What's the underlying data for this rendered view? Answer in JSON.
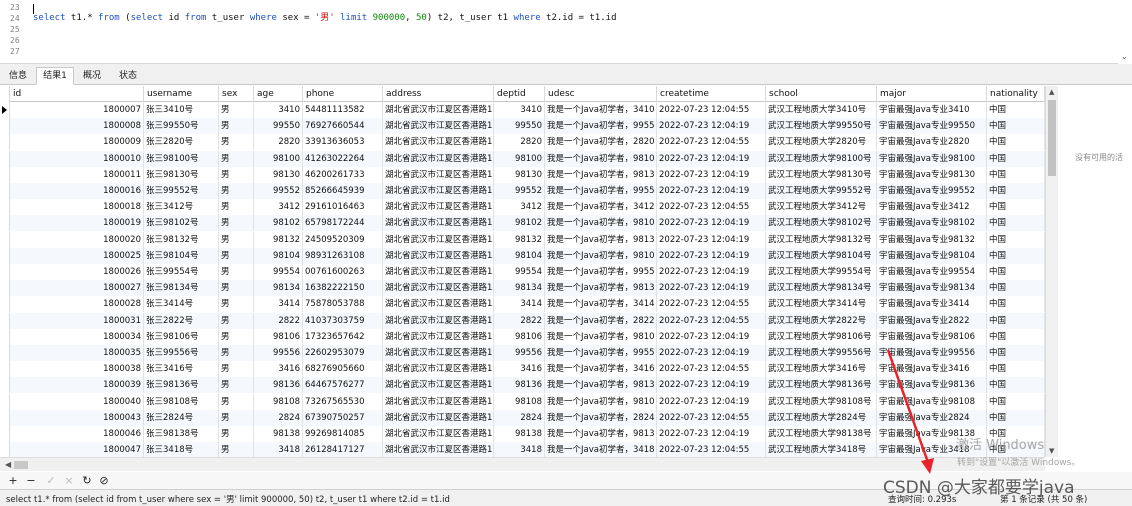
{
  "editor": {
    "line_numbers": [
      "23",
      "24",
      "25",
      "26",
      "27"
    ],
    "query_tokens": [
      {
        "t": "select",
        "c": "kw"
      },
      {
        "t": " t1.* ",
        "c": "txt"
      },
      {
        "t": "from",
        "c": "kw"
      },
      {
        "t": " (",
        "c": "txt"
      },
      {
        "t": "select",
        "c": "kw"
      },
      {
        "t": " id ",
        "c": "txt"
      },
      {
        "t": "from",
        "c": "kw"
      },
      {
        "t": " t_user ",
        "c": "txt"
      },
      {
        "t": "where",
        "c": "kw"
      },
      {
        "t": " sex = ",
        "c": "txt"
      },
      {
        "t": "'男'",
        "c": "str"
      },
      {
        "t": " ",
        "c": "txt"
      },
      {
        "t": "limit",
        "c": "kw"
      },
      {
        "t": " ",
        "c": "txt"
      },
      {
        "t": "900000",
        "c": "num"
      },
      {
        "t": ", ",
        "c": "txt"
      },
      {
        "t": "50",
        "c": "num"
      },
      {
        "t": ") t2, t_user t1 ",
        "c": "txt"
      },
      {
        "t": "where",
        "c": "kw"
      },
      {
        "t": " t2.id = t1.id",
        "c": "txt"
      }
    ]
  },
  "tabs": [
    "信息",
    "结果1",
    "概况",
    "状态"
  ],
  "active_tab": 1,
  "columns": [
    "id",
    "username",
    "sex",
    "age",
    "phone",
    "address",
    "deptid",
    "udesc",
    "createtime",
    "school",
    "major",
    "nationality"
  ],
  "rows": [
    [
      "1800007",
      "张三3410号",
      "男",
      "3410",
      "54481113582",
      "湖北省武汉市江夏区香港路1",
      "3410",
      "我是一个Java初学者，3410",
      "2022-07-23 12:04:55",
      "武汉工程地质大学3410号",
      "宇宙最强Java专业3410",
      "中国"
    ],
    [
      "1800008",
      "张三99550号",
      "男",
      "99550",
      "76927660544",
      "湖北省武汉市江夏区香港路1",
      "99550",
      "我是一个Java初学者，9955",
      "2022-07-23 12:04:19",
      "武汉工程地质大学99550号",
      "宇宙最强Java专业99550",
      "中国"
    ],
    [
      "1800009",
      "张三2820号",
      "男",
      "2820",
      "33913636053",
      "湖北省武汉市江夏区香港路1",
      "2820",
      "我是一个Java初学者，2820",
      "2022-07-23 12:04:55",
      "武汉工程地质大学2820号",
      "宇宙最强Java专业2820",
      "中国"
    ],
    [
      "1800010",
      "张三98100号",
      "男",
      "98100",
      "41263022264",
      "湖北省武汉市江夏区香港路1",
      "98100",
      "我是一个Java初学者，9810",
      "2022-07-23 12:04:19",
      "武汉工程地质大学98100号",
      "宇宙最强Java专业98100",
      "中国"
    ],
    [
      "1800011",
      "张三98130号",
      "男",
      "98130",
      "46200261733",
      "湖北省武汉市江夏区香港路1",
      "98130",
      "我是一个Java初学者，9813",
      "2022-07-23 12:04:19",
      "武汉工程地质大学98130号",
      "宇宙最强Java专业98130",
      "中国"
    ],
    [
      "1800016",
      "张三99552号",
      "男",
      "99552",
      "85266645939",
      "湖北省武汉市江夏区香港路1",
      "99552",
      "我是一个Java初学者，9955",
      "2022-07-23 12:04:19",
      "武汉工程地质大学99552号",
      "宇宙最强Java专业99552",
      "中国"
    ],
    [
      "1800018",
      "张三3412号",
      "男",
      "3412",
      "29161016463",
      "湖北省武汉市江夏区香港路1",
      "3412",
      "我是一个Java初学者，3412",
      "2022-07-23 12:04:55",
      "武汉工程地质大学3412号",
      "宇宙最强Java专业3412",
      "中国"
    ],
    [
      "1800019",
      "张三98102号",
      "男",
      "98102",
      "65798172244",
      "湖北省武汉市江夏区香港路1",
      "98102",
      "我是一个Java初学者，9810",
      "2022-07-23 12:04:19",
      "武汉工程地质大学98102号",
      "宇宙最强Java专业98102",
      "中国"
    ],
    [
      "1800020",
      "张三98132号",
      "男",
      "98132",
      "24509520309",
      "湖北省武汉市江夏区香港路1",
      "98132",
      "我是一个Java初学者，9813",
      "2022-07-23 12:04:19",
      "武汉工程地质大学98132号",
      "宇宙最强Java专业98132",
      "中国"
    ],
    [
      "1800025",
      "张三98104号",
      "男",
      "98104",
      "98931263108",
      "湖北省武汉市江夏区香港路1",
      "98104",
      "我是一个Java初学者，9810",
      "2022-07-23 12:04:19",
      "武汉工程地质大学98104号",
      "宇宙最强Java专业98104",
      "中国"
    ],
    [
      "1800026",
      "张三99554号",
      "男",
      "99554",
      "00761600263",
      "湖北省武汉市江夏区香港路1",
      "99554",
      "我是一个Java初学者，9955",
      "2022-07-23 12:04:19",
      "武汉工程地质大学99554号",
      "宇宙最强Java专业99554",
      "中国"
    ],
    [
      "1800027",
      "张三98134号",
      "男",
      "98134",
      "16382222150",
      "湖北省武汉市江夏区香港路1",
      "98134",
      "我是一个Java初学者，9813",
      "2022-07-23 12:04:19",
      "武汉工程地质大学98134号",
      "宇宙最强Java专业98134",
      "中国"
    ],
    [
      "1800028",
      "张三3414号",
      "男",
      "3414",
      "75878053788",
      "湖北省武汉市江夏区香港路1",
      "3414",
      "我是一个Java初学者，3414",
      "2022-07-23 12:04:55",
      "武汉工程地质大学3414号",
      "宇宙最强Java专业3414",
      "中国"
    ],
    [
      "1800031",
      "张三2822号",
      "男",
      "2822",
      "41037303759",
      "湖北省武汉市江夏区香港路1",
      "2822",
      "我是一个Java初学者，2822",
      "2022-07-23 12:04:55",
      "武汉工程地质大学2822号",
      "宇宙最强Java专业2822",
      "中国"
    ],
    [
      "1800034",
      "张三98106号",
      "男",
      "98106",
      "17323657642",
      "湖北省武汉市江夏区香港路1",
      "98106",
      "我是一个Java初学者，9810",
      "2022-07-23 12:04:19",
      "武汉工程地质大学98106号",
      "宇宙最强Java专业98106",
      "中国"
    ],
    [
      "1800035",
      "张三99556号",
      "男",
      "99556",
      "22602953079",
      "湖北省武汉市江夏区香港路1",
      "99556",
      "我是一个Java初学者，9955",
      "2022-07-23 12:04:19",
      "武汉工程地质大学99556号",
      "宇宙最强Java专业99556",
      "中国"
    ],
    [
      "1800038",
      "张三3416号",
      "男",
      "3416",
      "68276905660",
      "湖北省武汉市江夏区香港路1",
      "3416",
      "我是一个Java初学者，3416",
      "2022-07-23 12:04:55",
      "武汉工程地质大学3416号",
      "宇宙最强Java专业3416",
      "中国"
    ],
    [
      "1800039",
      "张三98136号",
      "男",
      "98136",
      "64467576277",
      "湖北省武汉市江夏区香港路1",
      "98136",
      "我是一个Java初学者，9813",
      "2022-07-23 12:04:19",
      "武汉工程地质大学98136号",
      "宇宙最强Java专业98136",
      "中国"
    ],
    [
      "1800040",
      "张三98108号",
      "男",
      "98108",
      "73267565530",
      "湖北省武汉市江夏区香港路1",
      "98108",
      "我是一个Java初学者，9810",
      "2022-07-23 12:04:19",
      "武汉工程地质大学98108号",
      "宇宙最强Java专业98108",
      "中国"
    ],
    [
      "1800043",
      "张三2824号",
      "男",
      "2824",
      "67390750257",
      "湖北省武汉市江夏区香港路1",
      "2824",
      "我是一个Java初学者，2824",
      "2022-07-23 12:04:55",
      "武汉工程地质大学2824号",
      "宇宙最强Java专业2824",
      "中国"
    ],
    [
      "1800046",
      "张三98138号",
      "男",
      "98138",
      "99269814085",
      "湖北省武汉市江夏区香港路1",
      "98138",
      "我是一个Java初学者，9813",
      "2022-07-23 12:04:19",
      "武汉工程地质大学98138号",
      "宇宙最强Java专业98138",
      "中国"
    ],
    [
      "1800047",
      "张三3418号",
      "男",
      "3418",
      "26128417127",
      "湖北省武汉市江夏区香港路1",
      "3418",
      "我是一个Java初学者，3418",
      "2022-07-23 12:04:55",
      "武汉工程地质大学3418号",
      "宇宙最强Java专业3418",
      "中国"
    ]
  ],
  "side_note": "没有可用的活",
  "nav_buttons": [
    {
      "icon": "plus-icon",
      "glyph": "+",
      "enabled": true
    },
    {
      "icon": "minus-icon",
      "glyph": "−",
      "enabled": true
    },
    {
      "icon": "check-icon",
      "glyph": "✓",
      "enabled": false
    },
    {
      "icon": "cross-icon",
      "glyph": "×",
      "enabled": false
    },
    {
      "icon": "refresh-icon",
      "glyph": "↻",
      "enabled": true
    },
    {
      "icon": "stop-icon",
      "glyph": "⊘",
      "enabled": true
    }
  ],
  "status": {
    "sql": "select t1.* from (select id from t_user where sex = '男' limit 900000, 50) t2, t_user t1 where t2.id = t1.id",
    "query_time": "查询时间: 0.293s",
    "records": "第 1 条记录 (共 50 条)"
  },
  "overlay": {
    "activate_title": "激活 Windows",
    "activate_sub": "转到\"设置\"以激活 Windows。",
    "csdn": "CSDN @大家都要学java",
    "arrow_color": "#e8232a"
  }
}
